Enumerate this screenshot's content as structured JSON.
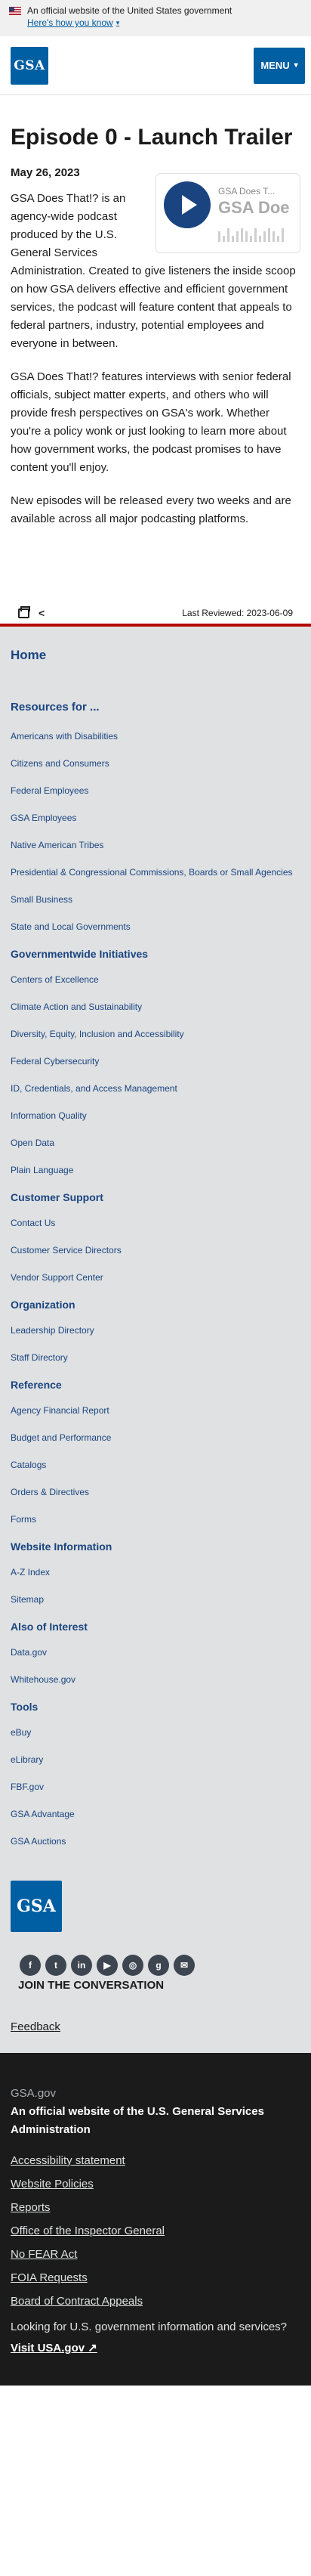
{
  "banner": {
    "text": "An official website of the United States government",
    "how_link": "Here's how you know"
  },
  "header": {
    "logo_text": "GSA",
    "menu_label": "MENU"
  },
  "article": {
    "title": "Episode 0 - Launch Trailer",
    "date": "May 26, 2023",
    "player": {
      "podcast_name": "GSA Does T...",
      "title_preview": "GSA Doe"
    },
    "paragraphs": [
      "GSA Does That!? is an agency-wide podcast produced by the U.S. General Services Administration. Created to give listeners the inside scoop on how GSA delivers effective and efficient government services, the podcast will feature content that appeals to federal partners, industry, potential employees and everyone in between.",
      "GSA Does That!? features interviews with senior federal officials, subject matter experts, and others who will provide fresh perspectives on GSA's work. Whether you're a policy wonk or just looking to learn more about how government works, the podcast promises to have content you'll enjoy.",
      "New episodes will be released every two weeks and are available across all major podcasting platforms."
    ],
    "last_reviewed": "Last Reviewed: 2023-06-09"
  },
  "nav": {
    "home": "Home",
    "resources_title": "Resources for ...",
    "resources": [
      "Americans with Disabilities",
      "Citizens and Consumers",
      "Federal Employees",
      "GSA Employees",
      "Native American Tribes",
      "Presidential & Congressional Commissions, Boards or Small Agencies",
      "Small Business",
      "State and Local Governments"
    ],
    "groups": [
      {
        "title": "Governmentwide Initiatives",
        "items": [
          "Centers of Excellence",
          "Climate Action and Sustainability",
          "Diversity, Equity, Inclusion and Accessibility",
          "Federal Cybersecurity",
          "ID, Credentials, and Access Management",
          "Information Quality",
          "Open Data",
          "Plain Language"
        ]
      },
      {
        "title": "Customer Support",
        "items": [
          "Contact Us",
          "Customer Service Directors",
          "Vendor Support Center"
        ]
      },
      {
        "title": "Organization",
        "items": [
          "Leadership Directory",
          "Staff Directory"
        ]
      },
      {
        "title": "Reference",
        "items": [
          "Agency Financial Report",
          "Budget and Performance",
          "Catalogs",
          "Orders & Directives",
          "Forms"
        ]
      },
      {
        "title": "Website Information",
        "items": [
          "A-Z Index",
          "Sitemap"
        ]
      },
      {
        "title": "Also of Interest",
        "items": [
          "Data.gov",
          "Whitehouse.gov"
        ]
      },
      {
        "title": "Tools",
        "items": [
          "eBuy",
          "eLibrary",
          "FBF.gov",
          "GSA Advantage",
          "GSA Auctions"
        ]
      }
    ]
  },
  "footer": {
    "logo_text": "GSA",
    "social": [
      "f",
      "t",
      "in",
      "▶",
      "◎",
      "g",
      "✉"
    ],
    "join": "JOIN THE CONVERSATION",
    "feedback": "Feedback"
  },
  "identifier": {
    "domain": "GSA.gov",
    "official": "An official website of the U.S. General Services Administration",
    "links": [
      "Accessibility statement",
      "Website Policies",
      "Reports",
      "Office of the Inspector General",
      "No FEAR Act",
      "FOIA Requests",
      "Board of Contract Appeals"
    ],
    "looking": "Looking for U.S. government information and services?",
    "visit": "Visit USA.gov"
  }
}
